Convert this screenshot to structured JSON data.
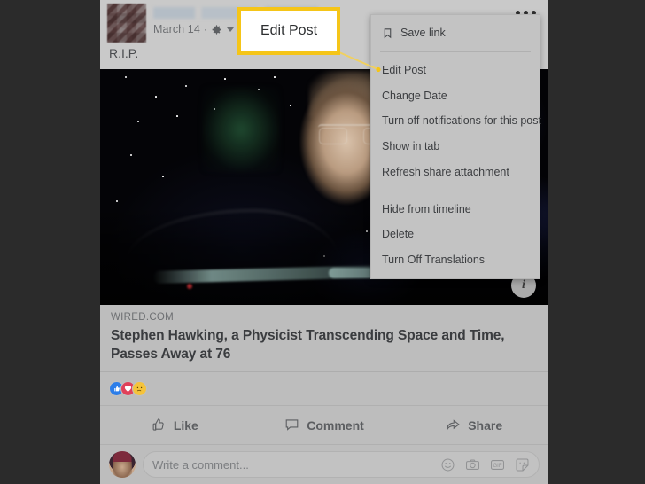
{
  "post": {
    "author_name_redacted": "",
    "date": "March 14",
    "separator": "·",
    "privacy_icon": "gear-icon",
    "caption": "R.I.P.",
    "more_options_icon": "ellipsis-icon",
    "photo_info_icon": "info-icon",
    "photo_alt": "Stephen Hawking in wheelchair against starfield background"
  },
  "link_preview": {
    "domain": "WIRED.COM",
    "title": "Stephen Hawking, a Physicist Transcending Space and Time, Passes Away at 76"
  },
  "reactions": {
    "items": [
      {
        "name": "like-reaction",
        "glyph": "▲",
        "color": "#2b7de9"
      },
      {
        "name": "love-reaction",
        "glyph": "♥",
        "color": "#e0415a"
      },
      {
        "name": "sad-reaction",
        "glyph": "☹",
        "color": "#f5c33b"
      }
    ]
  },
  "actions": {
    "like": "Like",
    "comment": "Comment",
    "share": "Share"
  },
  "comment_bar": {
    "placeholder": "Write a comment...",
    "icons": [
      "emoji-icon",
      "camera-icon",
      "gif-icon",
      "sticker-icon"
    ]
  },
  "menu": {
    "groups": [
      {
        "items": [
          {
            "label": "Save link",
            "icon": "bookmark-icon"
          }
        ]
      },
      {
        "items": [
          {
            "label": "Edit Post",
            "icon": ""
          },
          {
            "label": "Change Date",
            "icon": ""
          },
          {
            "label": "Turn off notifications for this post",
            "icon": ""
          },
          {
            "label": "Show in tab",
            "icon": ""
          },
          {
            "label": "Refresh share attachment",
            "icon": ""
          }
        ]
      },
      {
        "items": [
          {
            "label": "Hide from timeline",
            "icon": ""
          },
          {
            "label": "Delete",
            "icon": ""
          },
          {
            "label": "Turn Off Translations",
            "icon": ""
          }
        ]
      }
    ]
  },
  "callout": {
    "label": "Edit Post",
    "border_color": "#f5c518",
    "background": "#ffffff"
  },
  "theme": {
    "page_background": "#2b2b2b",
    "card_background": "#bdbdbd",
    "header_background": "#c9c9c9",
    "menu_background": "#c3c3c3",
    "text_primary": "#3c3e41",
    "text_secondary": "#6d6f72",
    "accent_highlight": "#f5c518"
  }
}
